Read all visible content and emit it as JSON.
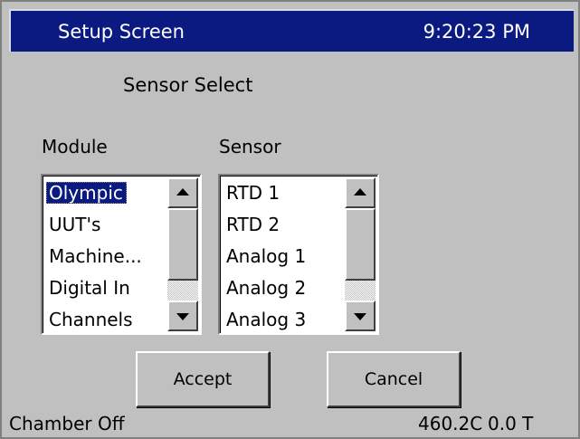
{
  "titlebar": {
    "title": "Setup Screen",
    "clock": "9:20:23 PM"
  },
  "heading": "Sensor Select",
  "module": {
    "label": "Module",
    "items": [
      "Olympic",
      "UUT's",
      "Machine...",
      "Digital In",
      "Channels"
    ],
    "selected": "Olympic"
  },
  "sensor": {
    "label": "Sensor",
    "items": [
      "RTD 1",
      "RTD 2",
      "Analog 1",
      "Analog 2",
      "Analog 3"
    ]
  },
  "buttons": {
    "accept": "Accept",
    "cancel": "Cancel"
  },
  "status": {
    "chamber": "Chamber Off",
    "temperature": "460.2C",
    "t_value": "0.0 T"
  },
  "icons": {
    "scroll_up": "triangle-up-icon",
    "scroll_down": "triangle-down-icon"
  },
  "colors": {
    "titlebar_bg": "#0b1a80",
    "selection_bg": "#0b1a80",
    "window_bg": "#c0c0c0"
  }
}
